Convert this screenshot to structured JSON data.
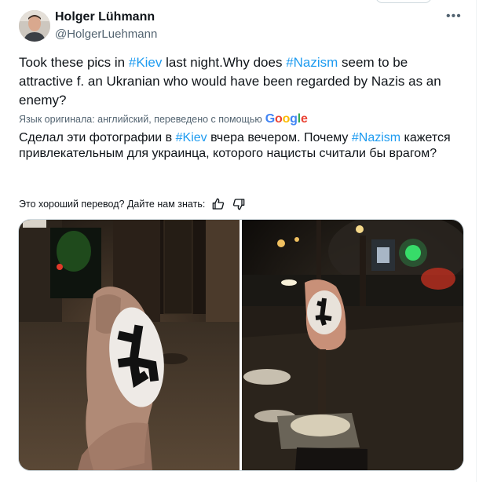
{
  "author": {
    "name": "Holger Lühmann",
    "handle": "@HolgerLuehmann"
  },
  "tweet": {
    "segments": [
      {
        "text": "Took these pics in ",
        "type": "text"
      },
      {
        "text": "#Kiev",
        "type": "hashtag"
      },
      {
        "text": " last night.Why does ",
        "type": "text"
      },
      {
        "text": "#Nazism",
        "type": "hashtag"
      },
      {
        "text": " seem to be attractive f. an Ukranian who would have been regarded by Nazis as an enemy?",
        "type": "text"
      }
    ]
  },
  "translation": {
    "note": "Язык оригинала: английский, переведено с помощью",
    "provider": "Google",
    "segments": [
      {
        "text": "Сделал эти фотографии в ",
        "type": "text"
      },
      {
        "text": "#Kiev",
        "type": "hashtag"
      },
      {
        "text": " вчера вечером. Почему ",
        "type": "text"
      },
      {
        "text": "#Nazism",
        "type": "hashtag"
      },
      {
        "text": " кажется привлекательным для украинца, которого нацисты считали бы врагом?",
        "type": "text"
      }
    ],
    "feedback_prompt": "Это хороший перевод? Дайте нам знать:"
  },
  "icons": {
    "more": "more-options-icon",
    "thumbs_up": "thumbs-up-icon",
    "thumbs_down": "thumbs-down-icon"
  },
  "colors": {
    "hashtag": "#1d9bf0",
    "secondary_text": "#536471",
    "border": "#cfd9de"
  }
}
